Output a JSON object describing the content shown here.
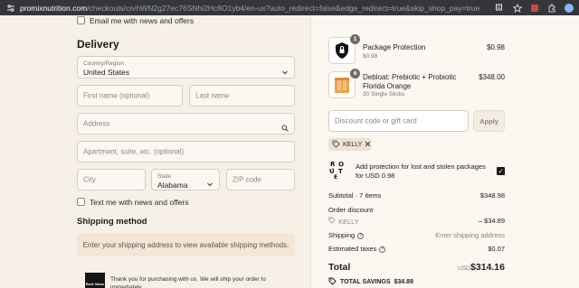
{
  "browser": {
    "url_domain": "promixnutrition.com",
    "url_rest": "/checkouts/cn/hWN2g27ec76SNhi2Hc8O1yb4/en-us?auto_redirect=false&edge_redirect=true&skip_shop_pay=true"
  },
  "email_news_label": "Email me with news and offers",
  "delivery": {
    "title": "Delivery",
    "country_label": "Country/Region",
    "country_value": "United States",
    "first_name_placeholder": "First name (optional)",
    "last_name_placeholder": "Last name",
    "address_placeholder": "Address",
    "apartment_placeholder": "Apartment, suite, etc. (optional)",
    "city_placeholder": "City",
    "state_label": "State",
    "state_value": "Alabama",
    "zip_placeholder": "ZIP code",
    "text_news_label": "Text me with news and offers"
  },
  "shipping_method": {
    "title": "Shipping method",
    "message": "Enter your shipping address to view available shipping methods."
  },
  "footer_note": {
    "badge_text": "Best Value",
    "text": "Thank you for purchasing with us. We will ship your order to immediately"
  },
  "order": {
    "items": [
      {
        "name": "Package Protection",
        "sub": "$0.98",
        "qty": "1",
        "price": "$0.98"
      },
      {
        "name": "Debloat: Prebiotic + Probiotic Florida Orange",
        "sub": "30 Single Sticks",
        "qty": "6",
        "price": "$348.00"
      }
    ],
    "discount_placeholder": "Discount code or gift card",
    "apply_label": "Apply",
    "applied_code": "KELLY",
    "protection": {
      "logo_text": "ROUTE",
      "text": "Add protection for lost and stolen packages for USD 0.98"
    },
    "subtotal_label": "Subtotal · 7 items",
    "subtotal_value": "$348.98",
    "order_discount_label": "Order discount",
    "discount_code": "KELLY",
    "discount_value": "– $34.89",
    "shipping_label": "Shipping",
    "shipping_value": "Enter shipping address",
    "taxes_label": "Estimated taxes",
    "taxes_value": "$0.07",
    "total_label": "Total",
    "total_currency": "USD",
    "total_value": "$314.16",
    "savings_label": "TOTAL SAVINGS",
    "savings_value": "$34.89"
  },
  "colors": {
    "left_bg": "#f7f0e6",
    "right_bg": "#fbf7f1",
    "shipping_box": "#f4e6d6",
    "product_orange": "#f0a24a"
  }
}
